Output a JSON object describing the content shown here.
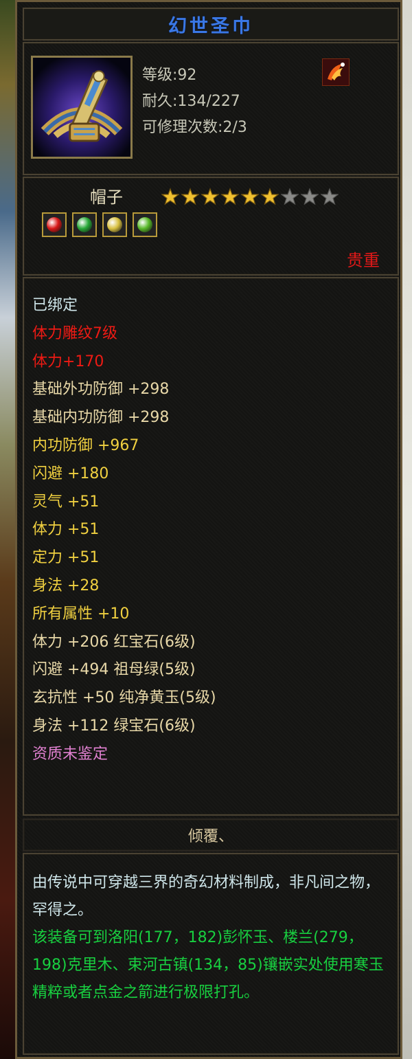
{
  "item": {
    "title": "幻世圣巾",
    "icon": "crown-headband-icon",
    "level": "等级:92",
    "durability": "耐久:134/227",
    "repairs": "可修理次数:2/3",
    "badge_icon": "phoenix-emblem-icon"
  },
  "rarity": {
    "type": "帽子",
    "stars_filled": 6,
    "stars_total": 9,
    "gem_icons": [
      "ruby-gem-icon",
      "emerald-gem-icon",
      "topaz-gem-icon",
      "jade-gem-icon"
    ],
    "quality": "贵重"
  },
  "attributes": [
    {
      "text": "已绑定",
      "color": "white"
    },
    {
      "text": "体力雕纹7级",
      "color": "red"
    },
    {
      "text": "体力+170",
      "color": "red"
    },
    {
      "text": "基础外功防御 +298",
      "color": "beige"
    },
    {
      "text": "基础内功防御 +298",
      "color": "beige"
    },
    {
      "text": "内功防御 +967",
      "color": "yellow"
    },
    {
      "text": "闪避 +180",
      "color": "yellow"
    },
    {
      "text": "灵气 +51",
      "color": "yellow"
    },
    {
      "text": "体力 +51",
      "color": "yellow"
    },
    {
      "text": "定力 +51",
      "color": "yellow"
    },
    {
      "text": "身法 +28",
      "color": "yellow"
    },
    {
      "text": "所有属性 +10",
      "color": "yellow"
    },
    {
      "text": "体力 +206 红宝石(6级)",
      "color": "beige"
    },
    {
      "text": "闪避 +494 祖母绿(5级)",
      "color": "beige"
    },
    {
      "text": "玄抗性 +50 纯净黄玉(5级)",
      "color": "beige"
    },
    {
      "text": "身法 +112 绿宝石(6级)",
      "color": "beige"
    },
    {
      "text": "资质未鉴定",
      "color": "pink"
    }
  ],
  "owner": "倾覆、",
  "description": {
    "lore": "由传说中可穿越三界的奇幻材料制成，非凡间之物，罕得之。",
    "hint": "该装备可到洛阳(177，182)彭怀玉、楼兰(279，198)克里木、束河古镇(134，85)镶嵌实处使用寒玉精粹或者点金之箭进行极限打孔。"
  },
  "colors": {
    "title": "#3a78e6",
    "quality": "#e01818",
    "attr_white": "#cfe6ea",
    "attr_red": "#ee1a14",
    "attr_yellow": "#f0d040",
    "attr_beige": "#e8d8a8",
    "attr_pink": "#e080d0",
    "desc_green": "#18d040"
  }
}
